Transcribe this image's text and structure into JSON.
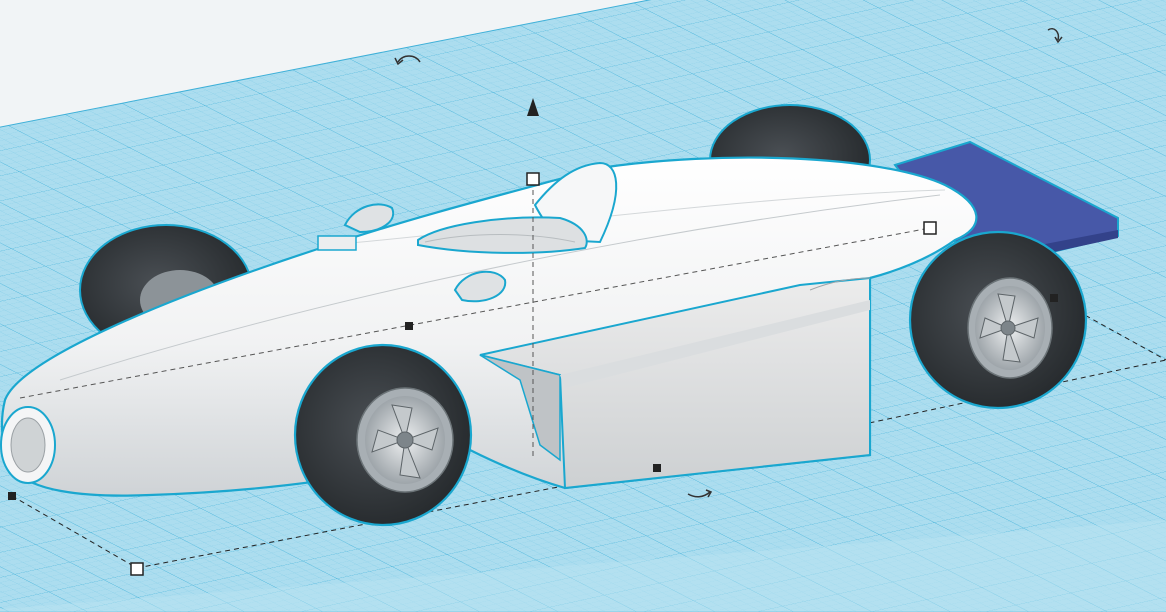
{
  "app": {
    "view": "3d-workplane"
  },
  "colors": {
    "workplane_fill": "#a9dcee",
    "grid_line": "#6cc4e2",
    "grid_line_major": "#3fb0d8",
    "selection_outline": "#1aa7cf",
    "body_white": "#f3f4f5",
    "tire": "#2b2f33",
    "rim": "#c9ced2",
    "rear_wing": "#4557a6",
    "handle": "#222222"
  },
  "scene": {
    "object": "race-car-model",
    "selected": true,
    "parts": [
      "body",
      "cockpit",
      "front-wheel-left",
      "front-wheel-right",
      "rear-wheel-left",
      "rear-wheel-right",
      "sidepod",
      "rear-wing",
      "mirror-left",
      "mirror-right"
    ]
  }
}
